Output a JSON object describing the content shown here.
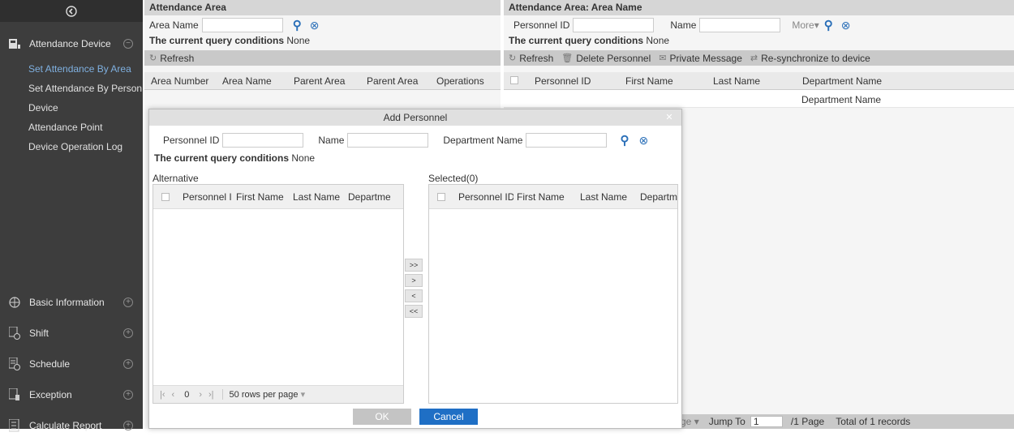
{
  "sidebar": {
    "top_icon": "chevron-circle-left",
    "group_attendance_device": "Attendance Device",
    "items": [
      {
        "label": "Set Attendance By Area",
        "active": true
      },
      {
        "label": "Set Attendance By Person",
        "active": false
      },
      {
        "label": "Device",
        "active": false
      },
      {
        "label": "Attendance Point",
        "active": false
      },
      {
        "label": "Device Operation Log",
        "active": false
      }
    ],
    "groups": [
      {
        "label": "Basic Information",
        "icon": "globe-icon"
      },
      {
        "label": "Shift",
        "icon": "shift-icon"
      },
      {
        "label": "Schedule",
        "icon": "schedule-icon"
      },
      {
        "label": "Exception",
        "icon": "exception-icon"
      },
      {
        "label": "Calculate Report",
        "icon": "report-icon"
      }
    ]
  },
  "left_panel": {
    "title": "Attendance Area",
    "area_name_label": "Area Name",
    "query_label": "The current query conditions",
    "query_value": "None",
    "refresh_label": "Refresh",
    "columns": [
      "Area Number",
      "Area Name",
      "Parent Area",
      "Parent Area",
      "Operations"
    ]
  },
  "right_panel": {
    "title": "Attendance Area: Area Name",
    "personnel_id_label": "Personnel ID",
    "name_label": "Name",
    "more_label": "More",
    "query_label": "The current query conditions",
    "query_value": "None",
    "toolbar": {
      "refresh": "Refresh",
      "delete_personnel": "Delete Personnel",
      "private_message": "Private Message",
      "resync": "Re-synchronize to device"
    },
    "columns": [
      "Personnel ID",
      "First Name",
      "Last Name",
      "Department Name"
    ],
    "row_department": "Department Name",
    "pager": {
      "page_frag": "ge",
      "jump_to": "Jump To",
      "jump_value": "1",
      "page_info": "/1 Page",
      "total": "Total of 1 records"
    }
  },
  "dialog": {
    "title": "Add Personnel",
    "personnel_id_label": "Personnel ID",
    "name_label": "Name",
    "department_label": "Department Name",
    "query_label": "The current query conditions",
    "query_value": "None",
    "alternative_label": "Alternative",
    "selected_label": "Selected(0)",
    "alt_columns": [
      "Personnel ID",
      "First Name",
      "Last Name",
      "Departme"
    ],
    "sel_columns": [
      "Personnel ID",
      "First Name",
      "Last Name",
      "Departme"
    ],
    "pager_count": "0",
    "rows_per_page": "50 rows per page",
    "move_all_right": ">>",
    "move_right": ">",
    "move_left": "<",
    "move_all_left": "<<",
    "ok_label": "OK",
    "cancel_label": "Cancel",
    "colors": {
      "ok": "#c4c4c4",
      "cancel": "#1f6fc5",
      "accent": "#2a6fb8"
    }
  }
}
